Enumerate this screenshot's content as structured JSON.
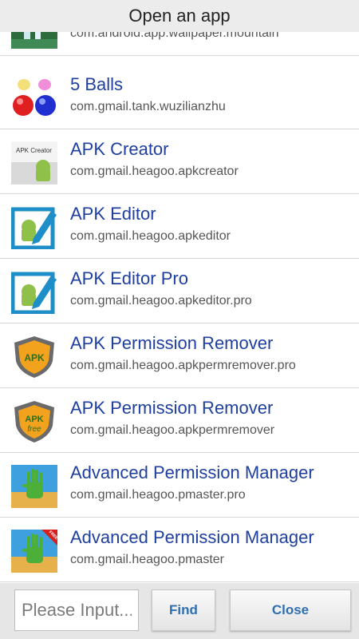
{
  "dialog": {
    "title": "Open an app"
  },
  "apps": [
    {
      "name": "",
      "package": "com.android.app.wallpaper.mountain",
      "icon": "mountain-waterfall-icon"
    },
    {
      "name": "5 Balls",
      "package": "com.gmail.tank.wuzilianzhu",
      "icon": "colored-balls-icon"
    },
    {
      "name": "APK Creator",
      "package": "com.gmail.heagoo.apkcreator",
      "icon": "apk-creator-icon",
      "icon_text": "APK Creator"
    },
    {
      "name": "APK Editor",
      "package": "com.gmail.heagoo.apkeditor",
      "icon": "apk-editor-icon"
    },
    {
      "name": "APK Editor Pro",
      "package": "com.gmail.heagoo.apkeditor.pro",
      "icon": "apk-editor-icon"
    },
    {
      "name": "APK Permission Remover",
      "package": "com.gmail.heagoo.apkpermremover.pro",
      "icon": "shield-apk-icon",
      "icon_text": "APK"
    },
    {
      "name": "APK Permission Remover",
      "package": "com.gmail.heagoo.apkpermremover",
      "icon": "shield-apk-free-icon",
      "icon_text": "APK",
      "icon_subtext": "free"
    },
    {
      "name": "Advanced Permission Manager",
      "package": "com.gmail.heagoo.pmaster.pro",
      "icon": "green-hand-icon"
    },
    {
      "name": "Advanced Permission Manager",
      "package": "com.gmail.heagoo.pmaster",
      "icon": "green-hand-free-icon",
      "icon_ribbon": "FREE"
    }
  ],
  "footer": {
    "search_placeholder": "Please Input...",
    "find_label": "Find",
    "close_label": "Close"
  },
  "colors": {
    "app_name": "#1f3fa0",
    "button_text": "#2f6fb0",
    "header_bg": "#ececec"
  }
}
